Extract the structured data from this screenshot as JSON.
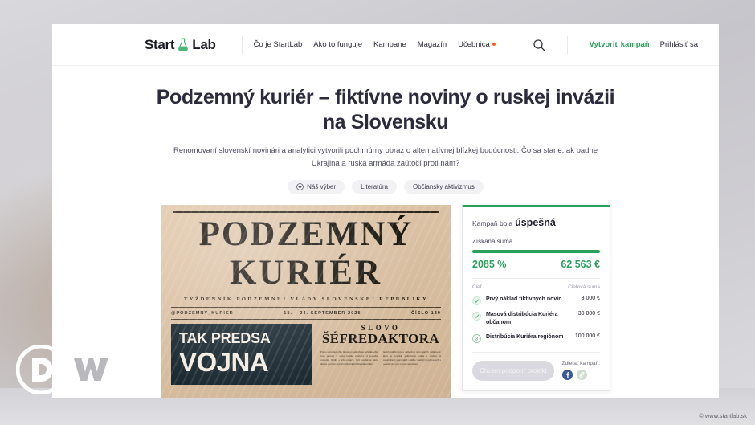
{
  "header": {
    "logo_start": "Start",
    "logo_lab": "Lab",
    "logo_icon": "flask-icon",
    "nav": [
      {
        "label": "Čo je StartLab",
        "badge": false
      },
      {
        "label": "Ako to funguje",
        "badge": false
      },
      {
        "label": "Kampane",
        "badge": false
      },
      {
        "label": "Magazín",
        "badge": false
      },
      {
        "label": "Učebnica",
        "badge": true
      }
    ],
    "search_icon": "search-icon",
    "create_campaign": "Vytvoriť kampaň",
    "login": "Prihlásiť sa"
  },
  "hero": {
    "title": "Podzemný kuriér – fiktívne noviny o ruskej invázii na Slovensku",
    "subtitle": "Renomovaní slovenskí novinári a analytici vytvorili pochmúrny obraz o alternatívnej blízkej budúcnosti. Čo sa stane, ak padne Ukrajina a ruská armáda zaútočí proti nám?",
    "tags": [
      {
        "label": "Náš výber",
        "icon": "heart-icon"
      },
      {
        "label": "Literatúra",
        "icon": ""
      },
      {
        "label": "Občiansky aktivizmus",
        "icon": ""
      }
    ]
  },
  "newspaper": {
    "masthead_line1": "PODZEMNÝ",
    "masthead_line2": "KURIÉR",
    "tagline": "TÝŽDENNÍK PODZEMNEJ VLÁDY SLOVENSKEJ REPUBLIKY",
    "handle": "@PODZEMNY_KURIER",
    "date": "18. – 24. SEPTEMBER 2028",
    "issue": "ČÍSLO 139",
    "headline_line1": "TAK PREDSA",
    "headline_line2": "VOJNA",
    "column_kicker": "SLOVO",
    "column_title": "ŠÉFREDAKTORA",
    "column_text_left": "Prešlo sotva niekoľko mesiacov, odkedy na začiatku tohto roka prestali v našej krajine existovať d posledné slobodné médiá a ich redakcie boli rozohnané alebo nútene prevzaté novými vlastníkmi blízkymi režimu.",
    "column_text_right": "naších publicistov a najlepších slovenských redaktorov, ktorí sa nevzdali požiadavke terénu a cestujú za reportážami, prepisujúci a sídlia v temných priestoroch a pokračujú v práci aj napriek riziku."
  },
  "campaign": {
    "status_prefix": "Kampaň bola",
    "status_value": "úspešná",
    "raised_label": "Získaná suma",
    "percent": "2085 %",
    "amount": "62 563 €",
    "progress_percent": 100,
    "col_goal": "Cieľ",
    "col_target": "Cieľová suma",
    "goals": [
      {
        "name": "Prvý náklad fiktívnych novín",
        "amount": "3 000 €",
        "state": "done",
        "marker": "check-icon"
      },
      {
        "name": "Masová distribúcia Kuriéra občanom",
        "amount": "30 000 €",
        "state": "done",
        "marker": "check-icon"
      },
      {
        "name": "Distribúcia Kuriéra regiónom",
        "amount": "100 000 €",
        "state": "pending",
        "marker": "3"
      }
    ],
    "support_button": "Chcem podporiť projekt",
    "share_label": "Zdieľať kampaň:",
    "share_icons": [
      {
        "name": "facebook-icon",
        "color": "#3b5998"
      },
      {
        "name": "link-icon",
        "color": "#cfd8cf"
      }
    ]
  },
  "watermark": {
    "logo": "DW",
    "credit": "© www.startlab.sk"
  },
  "colors": {
    "brand_green": "#2aa05a",
    "accent_orange": "#f2641e",
    "title": "#2b2b3d"
  }
}
